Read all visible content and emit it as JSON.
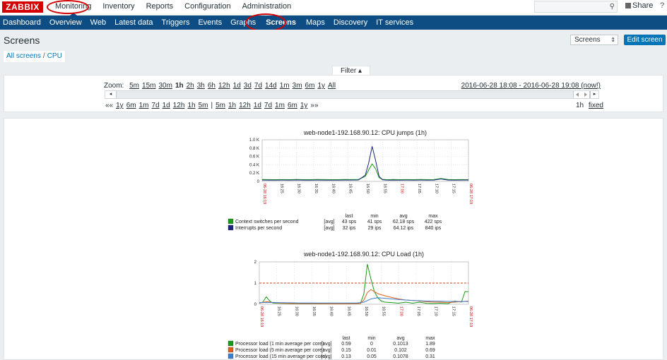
{
  "header": {
    "logo": "ZABBIX",
    "menu": [
      {
        "label": "Monitoring",
        "active": true
      },
      {
        "label": "Inventory"
      },
      {
        "label": "Reports"
      },
      {
        "label": "Configuration"
      },
      {
        "label": "Administration"
      }
    ],
    "share_label": "Share",
    "help_label": "?"
  },
  "subnav": [
    {
      "label": "Dashboard"
    },
    {
      "label": "Overview"
    },
    {
      "label": "Web"
    },
    {
      "label": "Latest data"
    },
    {
      "label": "Triggers"
    },
    {
      "label": "Events"
    },
    {
      "label": "Graphs"
    },
    {
      "label": "Screens",
      "active": true
    },
    {
      "label": "Maps"
    },
    {
      "label": "Discovery"
    },
    {
      "label": "IT services"
    }
  ],
  "page": {
    "title": "Screens",
    "screen_select": "Screens",
    "edit_button": "Edit screen"
  },
  "breadcrumb": {
    "all": "All screens",
    "sep": "/",
    "current": "CPU"
  },
  "filter": {
    "tab_label": "Filter ▴",
    "zoom_label": "Zoom:",
    "zoom_options": [
      "5m",
      "15m",
      "30m",
      "1h",
      "2h",
      "3h",
      "6h",
      "12h",
      "1d",
      "3d",
      "7d",
      "14d",
      "1m",
      "3m",
      "6m",
      "1y",
      "All"
    ],
    "zoom_active": "1h",
    "range": "2016-06-28 18:08 - 2016-06-28 19:08 (now!)",
    "nav_back": [
      "««",
      "1y",
      "6m",
      "1m",
      "7d",
      "1d",
      "12h",
      "1h",
      "5m"
    ],
    "nav_sep": "|",
    "nav_fwd": [
      "5m",
      "1h",
      "12h",
      "1d",
      "7d",
      "1m",
      "6m",
      "1y",
      "»»"
    ],
    "period": "1h",
    "fixed": "fixed"
  },
  "colors": {
    "accent": "#0e4d83",
    "brand": "#d40000",
    "button": "#0275b8"
  },
  "chart_data": [
    {
      "type": "line",
      "title": "web-node1-192.168.90.12: CPU jumps (1h)",
      "ylim": [
        0,
        1000
      ],
      "y_ticks": [
        "0",
        "0.2 K",
        "0.4 K",
        "0.6 K",
        "0.8 K",
        "1.0 K"
      ],
      "x_ticks": [
        "06-28 16:19",
        "16:25",
        "16:30",
        "16:35",
        "16:40",
        "16:45",
        "16:50",
        "16:55",
        "17:00",
        "17:05",
        "17:10",
        "17:15",
        "06-28 17:19"
      ],
      "legend_headers": [
        "last",
        "min",
        "avg",
        "max"
      ],
      "series": [
        {
          "name": "Context switches per second",
          "agg": "[avg]",
          "color": "#1a9a1a",
          "last": "43 sps",
          "min": "41 sps",
          "avg": "62.18 sps",
          "max": "422 sps",
          "x": [
            0,
            2,
            4,
            6,
            8,
            10,
            12,
            14,
            16,
            18,
            20,
            22,
            24,
            26,
            28,
            30,
            31,
            32,
            33,
            34,
            35,
            36,
            37,
            38,
            40,
            42,
            44,
            46,
            48,
            50,
            52,
            54,
            56,
            58,
            60
          ],
          "values": [
            45,
            42,
            43,
            44,
            42,
            46,
            43,
            42,
            45,
            44,
            42,
            43,
            45,
            44,
            46,
            120,
            280,
            420,
            300,
            90,
            50,
            44,
            43,
            45,
            42,
            44,
            43,
            45,
            42,
            44,
            70,
            45,
            43,
            44,
            43
          ]
        },
        {
          "name": "Interrupts per second",
          "agg": "[avg]",
          "color": "#1a237e",
          "last": "32 ips",
          "min": "29 ips",
          "avg": "64.12 ips",
          "max": "840 ips",
          "x": [
            0,
            2,
            4,
            6,
            8,
            10,
            12,
            14,
            16,
            18,
            20,
            22,
            24,
            26,
            28,
            30,
            31,
            32,
            33,
            34,
            35,
            36,
            37,
            38,
            40,
            42,
            44,
            46,
            48,
            50,
            52,
            54,
            56,
            58,
            60
          ],
          "values": [
            32,
            30,
            31,
            33,
            30,
            34,
            31,
            30,
            32,
            31,
            30,
            31,
            33,
            32,
            34,
            150,
            450,
            840,
            500,
            120,
            40,
            33,
            31,
            32,
            30,
            32,
            31,
            33,
            30,
            32,
            60,
            33,
            31,
            32,
            32
          ]
        }
      ]
    },
    {
      "type": "line",
      "title": "web-node1-192.168.90.12: CPU Load (1h)",
      "ylim": [
        0,
        2
      ],
      "y_ticks": [
        "0",
        "1",
        "2"
      ],
      "x_ticks": [
        "06-28 16:19",
        "16:25",
        "16:30",
        "16:35",
        "16:40",
        "16:45",
        "16:50",
        "16:55",
        "17:00",
        "17:05",
        "17:10",
        "17:15",
        "06-28 17:19"
      ],
      "trigger_line": 1,
      "legend_headers": [
        "last",
        "min",
        "avg",
        "max"
      ],
      "series": [
        {
          "name": "Processor load (1 min average per core)",
          "agg": "[avg]",
          "color": "#1a9a1a",
          "last": "0.59",
          "min": "0",
          "avg": "0.1013",
          "max": "1.89",
          "x": [
            0,
            1,
            2,
            3,
            4,
            6,
            8,
            10,
            15,
            20,
            25,
            29,
            30,
            31,
            32,
            33,
            34,
            35,
            36,
            38,
            40,
            42,
            44,
            46,
            48,
            50,
            52,
            54,
            56,
            58,
            59,
            60
          ],
          "values": [
            0.05,
            0.1,
            0.35,
            0.15,
            0.05,
            0.04,
            0.03,
            0.02,
            0.02,
            0.02,
            0.02,
            0.03,
            0.5,
            1.89,
            1.2,
            0.6,
            0.3,
            0.15,
            0.1,
            0.08,
            0.05,
            0.1,
            0.05,
            0.1,
            0.04,
            0.03,
            0.05,
            0.02,
            0.15,
            0.1,
            0.6,
            0.59
          ]
        },
        {
          "name": "Processor load (5 min average per core)",
          "agg": "[avg]",
          "color": "#e0601a",
          "last": "0.15",
          "min": "0.01",
          "avg": "0.102",
          "max": "0.69",
          "x": [
            0,
            2,
            4,
            6,
            10,
            15,
            20,
            25,
            29,
            30,
            31,
            32,
            33,
            34,
            36,
            38,
            40,
            42,
            44,
            46,
            48,
            50,
            52,
            54,
            56,
            58,
            60
          ],
          "values": [
            0.05,
            0.12,
            0.08,
            0.05,
            0.03,
            0.03,
            0.02,
            0.02,
            0.03,
            0.2,
            0.55,
            0.69,
            0.6,
            0.5,
            0.4,
            0.32,
            0.25,
            0.2,
            0.18,
            0.15,
            0.12,
            0.1,
            0.1,
            0.08,
            0.1,
            0.12,
            0.15
          ]
        },
        {
          "name": "Processor load (15 min average per core)",
          "agg": "[avg]",
          "color": "#3f7fd0",
          "last": "0.13",
          "min": "0.05",
          "avg": "0.1078",
          "max": "0.31",
          "x": [
            0,
            4,
            8,
            12,
            16,
            20,
            24,
            28,
            30,
            32,
            34,
            36,
            40,
            44,
            48,
            52,
            56,
            60
          ],
          "values": [
            0.08,
            0.08,
            0.07,
            0.06,
            0.06,
            0.06,
            0.06,
            0.06,
            0.1,
            0.25,
            0.31,
            0.28,
            0.22,
            0.18,
            0.15,
            0.14,
            0.13,
            0.13
          ]
        }
      ]
    }
  ]
}
